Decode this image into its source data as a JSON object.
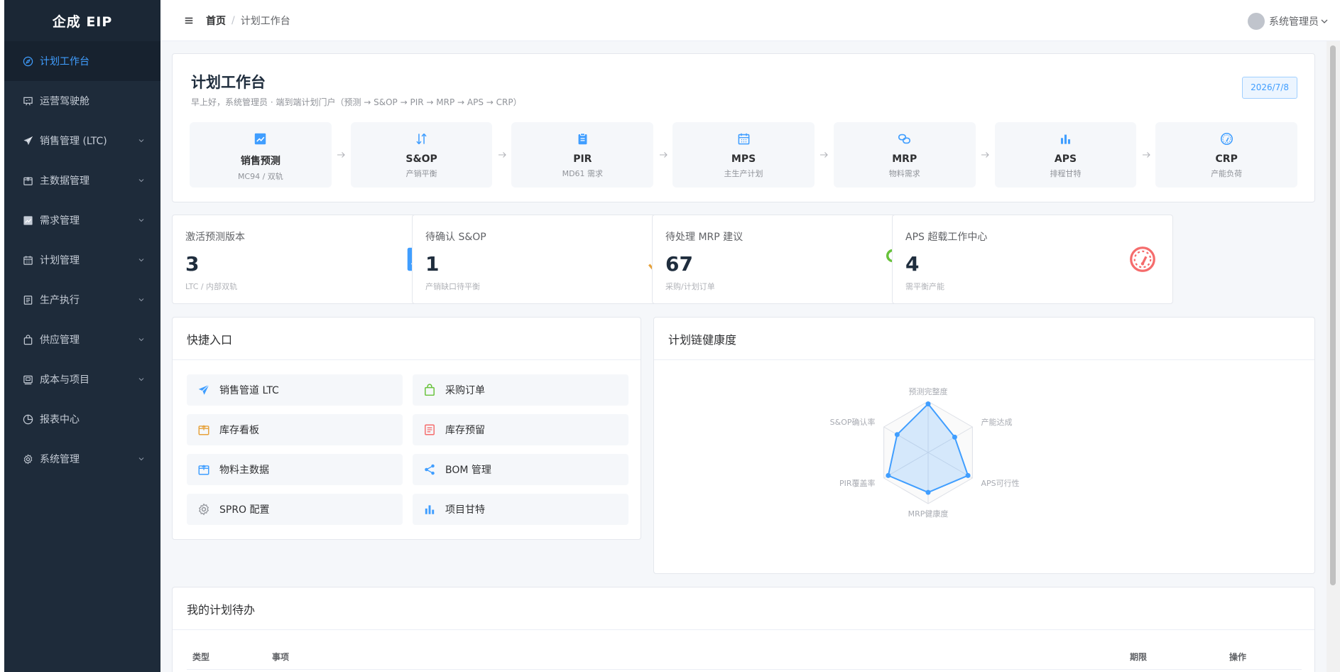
{
  "app": {
    "brand": "企成 EIP"
  },
  "sidebar": {
    "items": [
      {
        "label": "计划工作台",
        "icon": "compass-icon",
        "active": true
      },
      {
        "label": "运营驾驶舱",
        "icon": "presentation-icon"
      },
      {
        "label": "销售管理 (LTC)",
        "icon": "paper-plane-icon",
        "expandable": true
      },
      {
        "label": "主数据管理",
        "icon": "box-icon",
        "expandable": true
      },
      {
        "label": "需求管理",
        "icon": "trend-chart-icon",
        "expandable": true
      },
      {
        "label": "计划管理",
        "icon": "calendar-icon",
        "expandable": true
      },
      {
        "label": "生产执行",
        "icon": "tickets-icon",
        "expandable": true
      },
      {
        "label": "供应管理",
        "icon": "shopping-bag-icon",
        "expandable": true
      },
      {
        "label": "成本与项目",
        "icon": "money-icon",
        "expandable": true
      },
      {
        "label": "报表中心",
        "icon": "pie-chart-icon"
      },
      {
        "label": "系统管理",
        "icon": "gear-icon",
        "expandable": true
      }
    ]
  },
  "header": {
    "breadcrumb": {
      "home": "首页",
      "separator": "/",
      "current": "计划工作台"
    },
    "user": "系统管理员"
  },
  "hero": {
    "title": "计划工作台",
    "subtitle": "早上好，系统管理员 · 端到端计划门户（预测 → S&OP → PIR → MRP → APS → CRP）",
    "date": "2026/7/8",
    "steps": [
      {
        "name": "销售预测",
        "desc": "MC94 / 双轨",
        "icon": "trend-chart-icon"
      },
      {
        "name": "S&OP",
        "desc": "产销平衡",
        "icon": "sort-arrows-icon"
      },
      {
        "name": "PIR",
        "desc": "MD61 需求",
        "icon": "clipboard-icon"
      },
      {
        "name": "MPS",
        "desc": "主生产计划",
        "icon": "calendar-icon"
      },
      {
        "name": "MRP",
        "desc": "物料需求",
        "icon": "link-icon"
      },
      {
        "name": "APS",
        "desc": "排程甘特",
        "icon": "bar-chart-icon"
      },
      {
        "name": "CRP",
        "desc": "产能负荷",
        "icon": "gauge-icon"
      }
    ]
  },
  "stats": [
    {
      "title": "激活预测版本",
      "value": "3",
      "sub": "LTC / 内部双轨",
      "icon": "trend-chart-icon",
      "color": "#409eff"
    },
    {
      "title": "待确认 S&OP",
      "value": "1",
      "sub": "产销缺口待平衡",
      "icon": "sort-arrows-icon",
      "color": "#e6a23c"
    },
    {
      "title": "待处理 MRP 建议",
      "value": "67",
      "sub": "采购/计划订单",
      "icon": "link-icon",
      "color": "#67c23a"
    },
    {
      "title": "APS 超载工作中心",
      "value": "4",
      "sub": "需平衡产能",
      "icon": "gauge-icon",
      "color": "#f56c6c"
    }
  ],
  "quick": {
    "title": "快捷入口",
    "items": [
      {
        "label": "销售管道 LTC",
        "icon": "paper-plane-icon",
        "color": "#409eff"
      },
      {
        "label": "采购订单",
        "icon": "shopping-bag-icon",
        "color": "#67c23a"
      },
      {
        "label": "库存看板",
        "icon": "box-icon",
        "color": "#e6a23c"
      },
      {
        "label": "库存预留",
        "icon": "tickets-icon",
        "color": "#f56c6c"
      },
      {
        "label": "物料主数据",
        "icon": "box-icon",
        "color": "#409eff"
      },
      {
        "label": "BOM 管理",
        "icon": "share-icon",
        "color": "#409eff"
      },
      {
        "label": "SPRO 配置",
        "icon": "gear-icon",
        "color": "#909399"
      },
      {
        "label": "项目甘特",
        "icon": "bar-chart-icon",
        "color": "#409eff"
      }
    ]
  },
  "health": {
    "title": "计划链健康度",
    "indicators": [
      "预测完整度",
      "产能达成",
      "APS可行性",
      "MRP健康度",
      "PIR覆盖率",
      "S&OP确认率"
    ],
    "values": [
      0.95,
      0.6,
      0.9,
      0.78,
      0.9,
      0.7
    ],
    "color": "#409eff"
  },
  "todo": {
    "title": "我的计划待办",
    "columns": [
      "类型",
      "事项",
      "期限",
      "操作"
    ]
  }
}
